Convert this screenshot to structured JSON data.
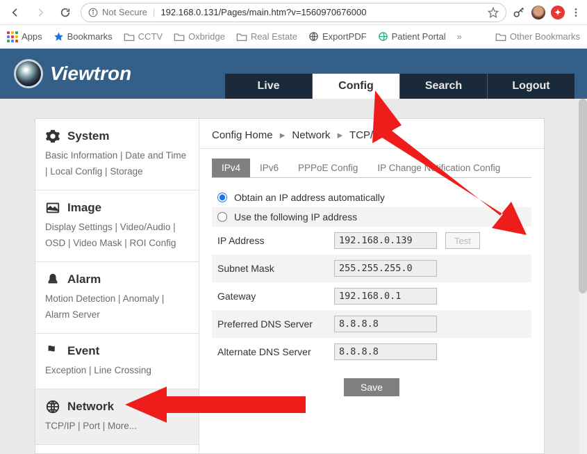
{
  "browser": {
    "security_label": "Not Secure",
    "url": "192.168.0.131/Pages/main.htm?v=1560970676000"
  },
  "bookmarks": {
    "apps": "Apps",
    "bookmarks": "Bookmarks",
    "cctv": "CCTV",
    "oxbridge": "Oxbridge",
    "real_estate": "Real Estate",
    "export_pdf": "ExportPDF",
    "patient_portal": "Patient Portal",
    "other": "Other Bookmarks"
  },
  "header": {
    "brand": "Viewtron",
    "tabs": {
      "live": "Live",
      "config": "Config",
      "search": "Search",
      "logout": "Logout"
    }
  },
  "sidebar": {
    "system": {
      "title": "System",
      "links": "Basic Information | Date and Time | Local Config | Storage"
    },
    "image": {
      "title": "Image",
      "links": "Display Settings | Video/Audio | OSD | Video Mask | ROI Config"
    },
    "alarm": {
      "title": "Alarm",
      "links": "Motion Detection | Anomaly | Alarm Server"
    },
    "event": {
      "title": "Event",
      "links": "Exception | Line Crossing"
    },
    "network": {
      "title": "Network",
      "links": "TCP/IP | Port | More..."
    }
  },
  "breadcrumb": {
    "a": "Config Home",
    "b": "Network",
    "c": "TCP/IP"
  },
  "subtabs": {
    "ipv4": "IPv4",
    "ipv6": "IPv6",
    "pppoe": "PPPoE Config",
    "ipchange": "IP Change Notification Config"
  },
  "form": {
    "radio_auto": "Obtain an IP address automatically",
    "radio_static": "Use the following IP address",
    "ip_label": "IP Address",
    "ip_value": "192.168.0.139",
    "test_label": "Test",
    "subnet_label": "Subnet Mask",
    "subnet_value": "255.255.255.0",
    "gateway_label": "Gateway",
    "gateway_value": "192.168.0.1",
    "dns1_label": "Preferred DNS Server",
    "dns1_value": "8.8.8.8",
    "dns2_label": "Alternate DNS Server",
    "dns2_value": "8.8.8.8",
    "save": "Save"
  }
}
